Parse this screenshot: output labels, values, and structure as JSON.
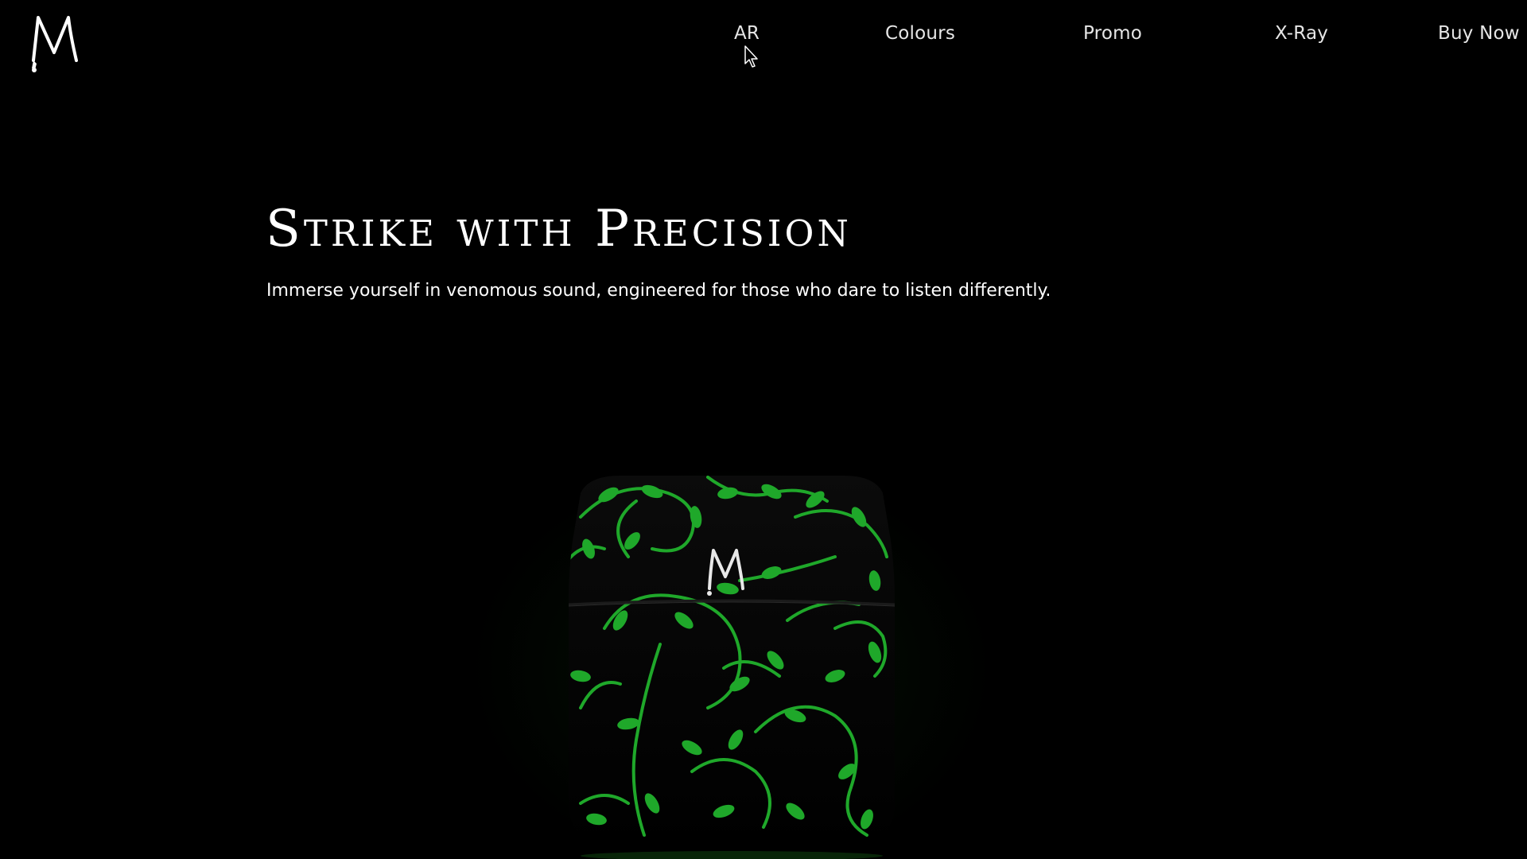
{
  "brand": {
    "logo_letter": "M",
    "accent_color": "#2fbf2f"
  },
  "nav": {
    "items": [
      {
        "label": "AR"
      },
      {
        "label": "Colours"
      },
      {
        "label": "Promo"
      },
      {
        "label": "X-Ray"
      },
      {
        "label": "Buy Now"
      }
    ]
  },
  "hero": {
    "title": "Strike with Precision",
    "subtitle": "Immerse yourself in venomous sound, engineered for those who dare to listen differently."
  },
  "product": {
    "case_logo": "M",
    "pattern_icon": "vine-leaf-pattern",
    "vine_color": "#1fa82a"
  },
  "cursor": {
    "icon": "mouse-pointer-icon"
  }
}
